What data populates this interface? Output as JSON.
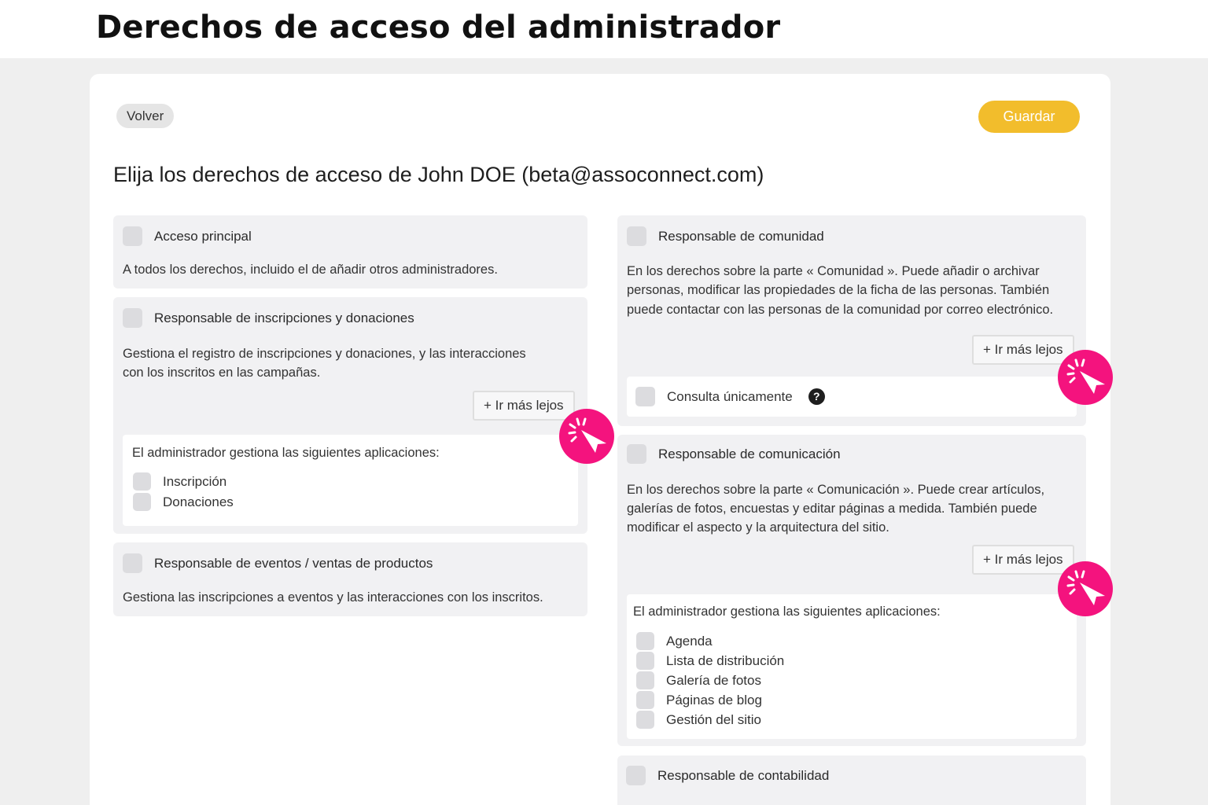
{
  "page": {
    "title": "Derechos de acceso del administrador"
  },
  "toolbar": {
    "back_label": "Volver",
    "save_label": "Guardar"
  },
  "heading": "Elija los derechos de acceso de John DOE (beta@assoconnect.com)",
  "colors": {
    "save": "#f2bd2c",
    "highlight": "#f4137e",
    "panel": "#f1f1f3"
  },
  "left": {
    "main_access": {
      "title": "Acceso principal",
      "desc": "A todos los derechos, incluido el de añadir otros administradores."
    },
    "registrations": {
      "title": "Responsable de inscripciones y donaciones",
      "desc1": "Gestiona el registro de inscripciones y donaciones, y las interacciones",
      "desc2": "con los inscritos en las campañas.",
      "more": "+ Ir más lejos",
      "apps_label": "El administrador gestiona las siguientes aplicaciones:",
      "apps": [
        "Inscripción",
        "Donaciones"
      ]
    },
    "events": {
      "title": "Responsable de eventos / ventas de productos",
      "desc": "Gestiona las inscripciones a eventos y las interacciones con los inscritos."
    }
  },
  "right": {
    "community": {
      "title": "Responsable de comunidad",
      "desc1": "En los derechos sobre la parte « Comunidad ». Puede añadir o archivar",
      "desc2": "personas, modificar las propiedades de la ficha de las personas. También",
      "desc3": "puede contactar con las personas de la comunidad por correo electrónico.",
      "more": "+ Ir más lejos",
      "readonly": "Consulta únicamente",
      "help_icon": "question-circle-icon"
    },
    "communication": {
      "title": "Responsable de comunicación",
      "desc1": "En los derechos sobre la parte « Comunicación ». Puede crear artículos,",
      "desc2": "galerías de fotos, encuestas y editar páginas a medida. También puede",
      "desc3": "modificar el aspecto y la arquitectura del sitio.",
      "more": "+ Ir más lejos",
      "apps_label": "El administrador gestiona las siguientes aplicaciones:",
      "apps": [
        "Agenda",
        "Lista de distribución",
        "Galería de fotos",
        "Páginas de blog",
        "Gestión del sitio"
      ]
    },
    "accounting": {
      "title": "Responsable de contabilidad"
    }
  }
}
